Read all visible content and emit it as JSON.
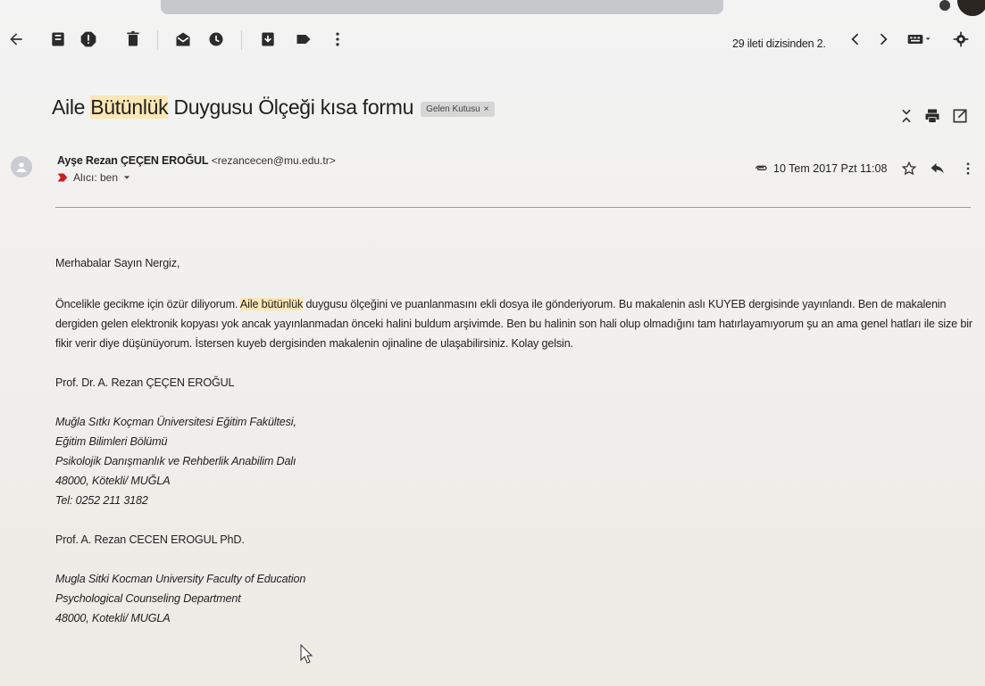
{
  "toolbar": {
    "counter": "29 ileti dizisinden 2.",
    "icons": [
      "back-icon",
      "archive-icon",
      "spam-icon",
      "delete-icon",
      "mark-unread-icon",
      "snooze-icon",
      "move-to-icon",
      "label-icon",
      "more-icon",
      "prev-icon",
      "next-icon",
      "input-tools-icon",
      "settings-icon"
    ]
  },
  "subject": {
    "part1": "Aile ",
    "part2_highlight": "Bütünlük",
    "part3": " Duygusu Ölçeği kısa formu",
    "label": "Gelen Kutusu",
    "label_close": "×"
  },
  "sender": {
    "name": "Ayşe Rezan ÇEÇEN EROĞUL",
    "email": "<rezancecen@mu.edu.tr>",
    "recipient": "Alıcı: ben"
  },
  "meta": {
    "date": "10 Tem 2017 Pzt 11:08"
  },
  "body": {
    "greeting": "Merhabalar Sayın Nergiz,",
    "line1_pre": "Öncelikle gecikme için özür diliyorum. ",
    "line1_hl": "Aile bütünlük",
    "line1_post": " duygusu ölçeğini ve puanlanmasını ekli dosya ile gönderiyorum. Bu makalenin aslı KUYEB dergisinde yayınlandı. Ben de makalenin",
    "line2": "dergiden gelen elektronik kopyası yok ancak yayınlanmadan önceki halini buldum arşivimde. Ben bu halinin son hali olup olmadığını tam hatırlayamıyorum şu an ama genel hatları ile size bir",
    "line3": "fikir verir diye düşünüyorum. İstersen kuyeb dergisinden makalenin ojinaline de ulaşabilirsiniz. Kolay gelsin.",
    "sig1": "Prof. Dr. A. Rezan ÇEÇEN EROĞUL",
    "sig_tr": [
      "Muğla Sıtkı Koçman Üniversitesi Eğitim Fakültesi,",
      "Eğitim Bilimleri Bölümü",
      "Psikolojik Danışmanlık ve Rehberlik Anabilim Dalı",
      "48000, Kötekli/ MUĞLA",
      "Tel: 0252 211 3182"
    ],
    "sig2": "Prof. A. Rezan CECEN EROGUL PhD.",
    "sig_en": [
      "Mugla Sitki Kocman University Faculty of Education",
      "Psychological Counseling Department",
      "48000, Kotekli/ MUGLA"
    ]
  },
  "colors": {
    "highlight": "#fbe7b5",
    "label_bg": "#d6d6d6"
  }
}
